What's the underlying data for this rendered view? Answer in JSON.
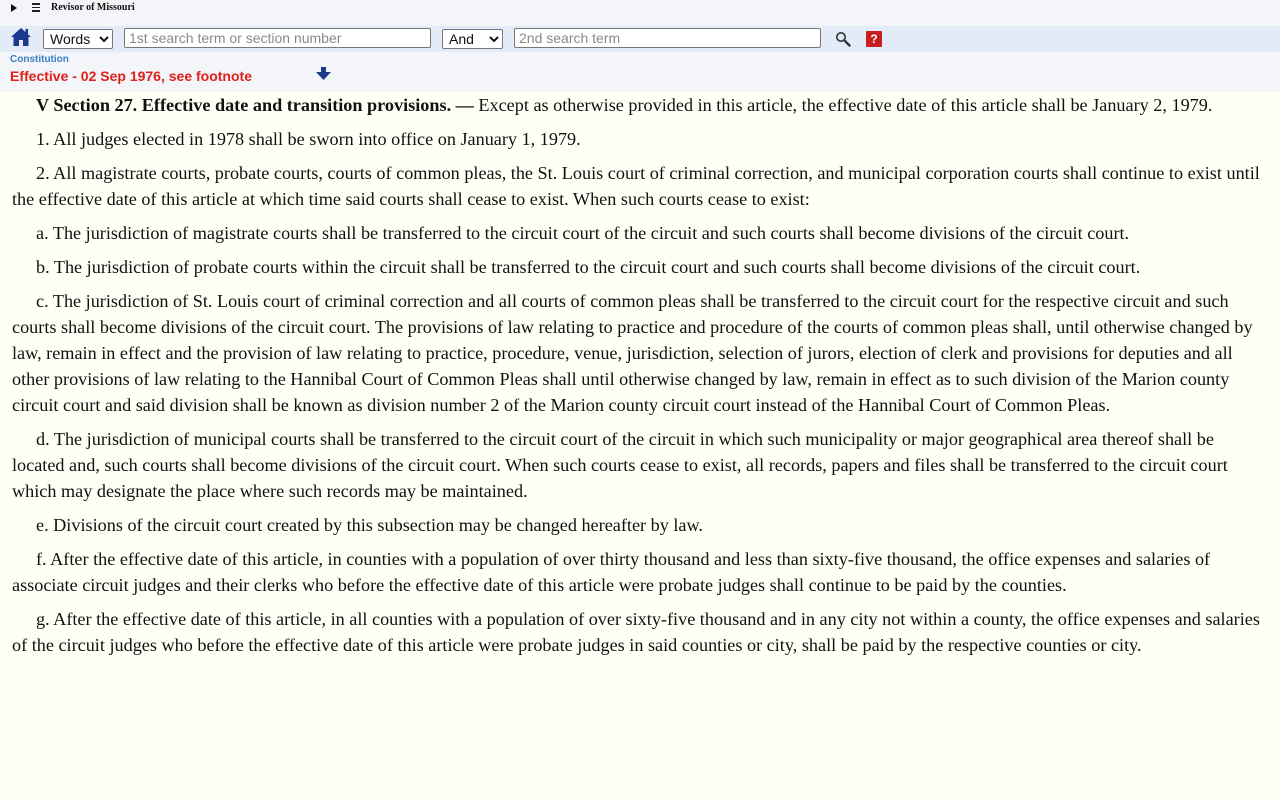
{
  "header": {
    "site_title": "Revisor of Missouri",
    "search": {
      "mode_selected": "Words",
      "mode_options": [
        "Words"
      ],
      "term1_placeholder": "1st search term or section number",
      "operator_selected": "And",
      "operator_options": [
        "And"
      ],
      "term2_placeholder": "2nd search term",
      "help_label": "?"
    }
  },
  "breadcrumb": "Constitution",
  "effective": "Effective - 02 Sep 1976, see footnote",
  "colors": {
    "effective": "#e0201c",
    "breadcrumb": "#3b7fc4",
    "toolbar_bg": "#e4ebf8",
    "page_bg": "#fffff5"
  },
  "section": {
    "heading": "V Section 27.  Effective date and transition provisions. —",
    "intro": " Except as otherwise provided in this article, the effective date of this article shall be January 2, 1979.",
    "paragraphs": [
      "1.  All judges elected in 1978 shall be sworn into office on January 1, 1979.",
      "2.  All magistrate courts, probate courts, courts of common pleas, the St. Louis court of criminal correction, and municipal corporation courts shall continue to exist until the effective date of this article at which time said courts shall cease to exist.  When such courts cease to exist:",
      "a.  The jurisdiction of magistrate courts shall be transferred to the circuit court of the circuit and such courts shall become divisions of the circuit court.",
      "b.  The jurisdiction of probate courts within the circuit shall be transferred to the circuit court and such courts shall become divisions of the circuit court.",
      "c.  The jurisdiction of St. Louis court of criminal correction and all courts of common pleas shall be transferred to the circuit court for the respective circuit and such courts shall become divisions of the circuit court.  The provisions of law relating to practice and procedure of the courts of common pleas shall, until otherwise changed by law, remain in effect and the provision of law relating to practice, procedure, venue, jurisdiction, selection of jurors, election of clerk and provisions for deputies and all other provisions of law relating to the Hannibal Court of Common Pleas shall until otherwise changed by law, remain in effect as to such division of the Marion county circuit court and said division shall be known as division number 2 of the Marion county circuit court instead of the Hannibal Court of Common Pleas.",
      "d.  The jurisdiction of municipal courts shall be transferred to the circuit court of the circuit in which such municipality or major geographical area thereof shall be located and, such courts shall become divisions of the circuit court.  When such courts cease to exist, all records, papers and files shall be transferred to the circuit court which may designate the place where such records may be maintained.",
      "e.  Divisions of the circuit court created by this subsection may be changed hereafter by law.",
      "f.  After the effective date of this article, in counties with a population of over thirty thousand and less than sixty-five thousand, the office expenses and salaries of associate circuit judges and their clerks who before the effective date of this article were probate judges shall continue to be paid by the counties.",
      "g.  After the effective date of this article, in all counties with a population of over sixty-five thousand and in any city not within a county, the office expenses and salaries of the circuit judges who before the effective date of this article were probate judges in said counties or city, shall be paid by the respective counties or city."
    ]
  },
  "icons": {
    "expand": "triangle-right-icon",
    "menu": "hamburger-icon",
    "home": "home-icon",
    "search": "magnifier-icon",
    "help": "help-icon",
    "footnote": "down-arrow-icon"
  }
}
